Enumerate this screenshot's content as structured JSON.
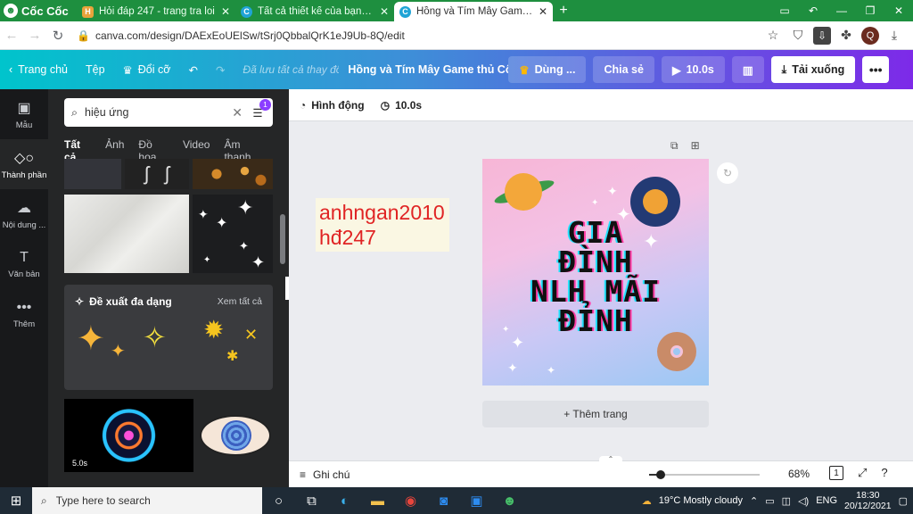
{
  "browser": {
    "brand": "Cốc Cốc",
    "tabs": [
      {
        "title": "Hỏi đáp 247 - trang tra loi",
        "fav_color": "#e8a33b",
        "fav_glyph": "H",
        "active": false
      },
      {
        "title": "Tất cả thiết kế của bạn - Can",
        "fav_color": "#20a4d6",
        "fav_glyph": "C",
        "active": false
      },
      {
        "title": "Hồng và Tím Mây Game thủ",
        "fav_color": "#20a4d6",
        "fav_glyph": "C",
        "active": true
      }
    ],
    "url": "canva.com/design/DAExEoUElSw/tSrj0QbbalQrK1eJ9Ub-8Q/edit",
    "profile_initial": "Q"
  },
  "header": {
    "home": "Trang chủ",
    "file": "Tệp",
    "resize": "Đổi cỡ",
    "saved": "Đã lưu tất cả thay đổi",
    "title": "Hồng và Tím Mây Game thủ Cô ...",
    "pro": "Dùng ...",
    "share": "Chia sẻ",
    "duration": "10.0s",
    "download": "Tải xuống"
  },
  "rail": [
    {
      "label": "Mẫu",
      "icon": "template-icon",
      "active": false
    },
    {
      "label": "Thành phần",
      "icon": "elements-icon",
      "active": true
    },
    {
      "label": "Nội dung ...",
      "icon": "upload-icon",
      "active": false
    },
    {
      "label": "Văn bản",
      "icon": "text-icon",
      "active": false
    },
    {
      "label": "Thêm",
      "icon": "more-icon",
      "active": false
    }
  ],
  "panel": {
    "search_value": "hiệu ứng",
    "filter_badge": "1",
    "tabs": [
      "Tất cả",
      "Ảnh",
      "Đồ họa",
      "Video",
      "Âm thanh"
    ],
    "suggest_title": "Đề xuất đa dạng",
    "see_all": "Xem tất cả",
    "video_duration": "5.0s"
  },
  "editor": {
    "animate": "Hình động",
    "duration": "10.0s",
    "text_box": [
      "anhngan2010",
      "hđ247"
    ],
    "design_text": [
      "GIA",
      "ĐÌNH",
      "NLH MÃI",
      "ĐỈNH"
    ],
    "add_page": "+ Thêm trang",
    "notes": "Ghi chú",
    "zoom": "68%",
    "zoom_level": 0.68,
    "page_count": "1"
  },
  "taskbar": {
    "search_placeholder": "Type here to search",
    "weather": "19°C  Mostly cloudy",
    "lang": "ENG",
    "time": "18:30",
    "date": "20/12/2021"
  }
}
